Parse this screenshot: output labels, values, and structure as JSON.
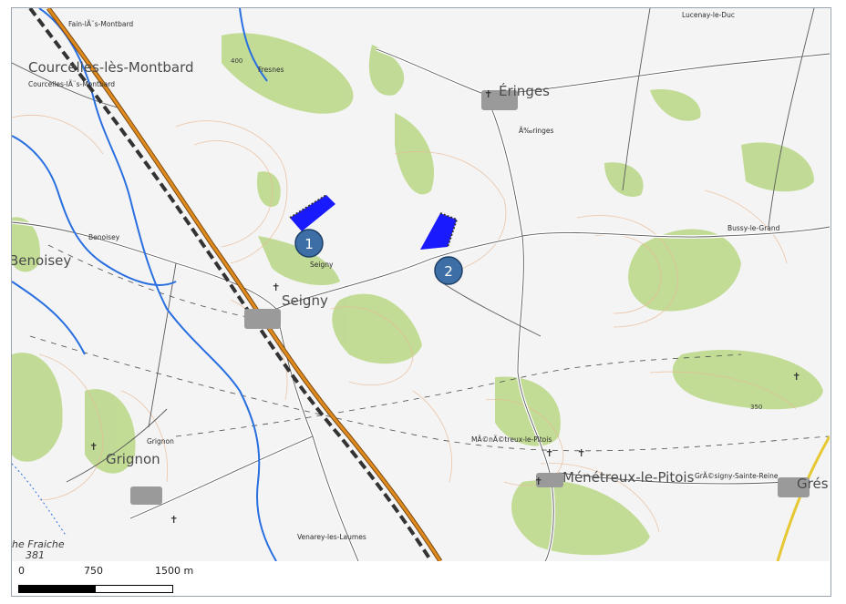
{
  "places": {
    "courcelles_big": "Courcelles-lès-Montbard",
    "courcelles_small": "Courcelles-lÃ¨s-Montbard",
    "fain": "Fain-lÃ¨s-Montbard",
    "fresnes": "Fresnes",
    "lucenay": "Lucenay-le-Duc",
    "eringes_big": "Éringes",
    "eringes_small": "Ã‰ringes",
    "bussy": "Bussy-le-Grand",
    "benoisey": "Benoisey",
    "benoisey_big": "Benoisey",
    "seigny_small": "Seigny",
    "seigny_big": "Seigny",
    "grignon_small": "Grignon",
    "grignon_big": "Grignon",
    "menetreux_small": "MÃ©nÃ©treux-le-Pitois",
    "menetreux_big": "Ménétreux-le-Pitois",
    "grignon_sainte_reine": "GrÃ©signy-Sainte-Reine",
    "gres": "Grés",
    "venarey": "Venarey-les-Laumes",
    "fraiche": "he Fraiche",
    "elev_381": "381",
    "contour_400": "400",
    "contour_350": "350"
  },
  "markers": [
    {
      "label": "1",
      "kind": "site-number"
    },
    {
      "label": "2",
      "kind": "site-number"
    }
  ],
  "colors": {
    "site_fill": "#1a1aff",
    "marker_fill": "#3d6fa6",
    "water": "#2a6fe0",
    "motorway": "#e08a1e",
    "forest": "#b9d98a",
    "contour": "#e8b48a"
  },
  "scale_bar": {
    "label_0": "0",
    "label_750": "750",
    "label_1500": "1500 m"
  }
}
